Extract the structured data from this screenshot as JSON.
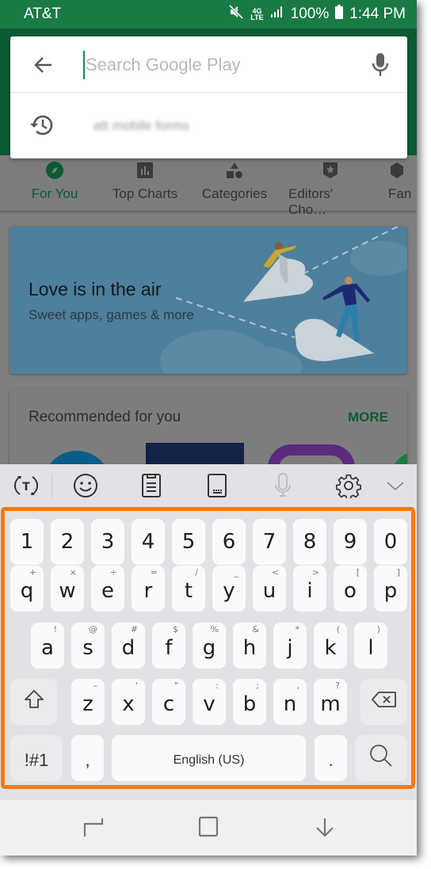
{
  "status_bar": {
    "carrier": "AT&T",
    "network": "4G",
    "network_sub": "LTE",
    "battery": "100%",
    "time": "1:44 PM",
    "icons": [
      "mute-icon",
      "lte-icon",
      "signal-icon",
      "battery-icon"
    ]
  },
  "search": {
    "placeholder": "Search Google Play",
    "value": "",
    "history": [
      {
        "text": "att mobile forms",
        "blurred": true
      }
    ]
  },
  "category_tabs": [
    {
      "label": "For You",
      "icon": "compass-icon",
      "active": true
    },
    {
      "label": "Top Charts",
      "icon": "chart-icon",
      "active": false
    },
    {
      "label": "Categories",
      "icon": "shapes-icon",
      "active": false
    },
    {
      "label": "Editors' Cho…",
      "icon": "badge-star-icon",
      "active": false
    },
    {
      "label": "Fan",
      "icon": "family-icon",
      "active": false
    }
  ],
  "banner": {
    "title": "Love is in the air",
    "subtitle": "Sweet apps, games & more"
  },
  "recommended": {
    "title": "Recommended for you",
    "more_label": "MORE"
  },
  "keyboard": {
    "toolbar": [
      "text-mode-icon",
      "emoji-icon",
      "clipboard-icon",
      "keyboard-size-icon",
      "voice-input-icon",
      "settings-icon",
      "collapse-icon"
    ],
    "number_row": [
      "1",
      "2",
      "3",
      "4",
      "5",
      "6",
      "7",
      "8",
      "9",
      "0"
    ],
    "row1": [
      {
        "k": "q",
        "h": "+"
      },
      {
        "k": "w",
        "h": "×"
      },
      {
        "k": "e",
        "h": "÷"
      },
      {
        "k": "r",
        "h": "="
      },
      {
        "k": "t",
        "h": "/"
      },
      {
        "k": "y",
        "h": "_"
      },
      {
        "k": "u",
        "h": "<"
      },
      {
        "k": "i",
        "h": ">"
      },
      {
        "k": "o",
        "h": "["
      },
      {
        "k": "p",
        "h": "]"
      }
    ],
    "row2": [
      {
        "k": "a",
        "h": "!"
      },
      {
        "k": "s",
        "h": "@"
      },
      {
        "k": "d",
        "h": "#"
      },
      {
        "k": "f",
        "h": "$"
      },
      {
        "k": "g",
        "h": "%"
      },
      {
        "k": "h",
        "h": "&"
      },
      {
        "k": "j",
        "h": "*"
      },
      {
        "k": "k",
        "h": "("
      },
      {
        "k": "l",
        "h": ")"
      }
    ],
    "row3": [
      {
        "k": "z",
        "h": "–"
      },
      {
        "k": "x",
        "h": "'"
      },
      {
        "k": "c",
        "h": "\""
      },
      {
        "k": "v",
        "h": ":"
      },
      {
        "k": "b",
        "h": ";"
      },
      {
        "k": "n",
        "h": ","
      },
      {
        "k": "m",
        "h": "?"
      }
    ],
    "symbols_label": "!#1",
    "comma": ",",
    "space_label": "English (US)",
    "period": ".",
    "highlight_color": "#f87a0e"
  },
  "nav_bar": [
    "recents-icon",
    "home-icon",
    "back-icon"
  ],
  "colors": {
    "status_green": "#1a7a45",
    "header_green": "#0b5a31",
    "accent_green": "#0c5a32",
    "highlight_orange": "#f87a0e"
  }
}
